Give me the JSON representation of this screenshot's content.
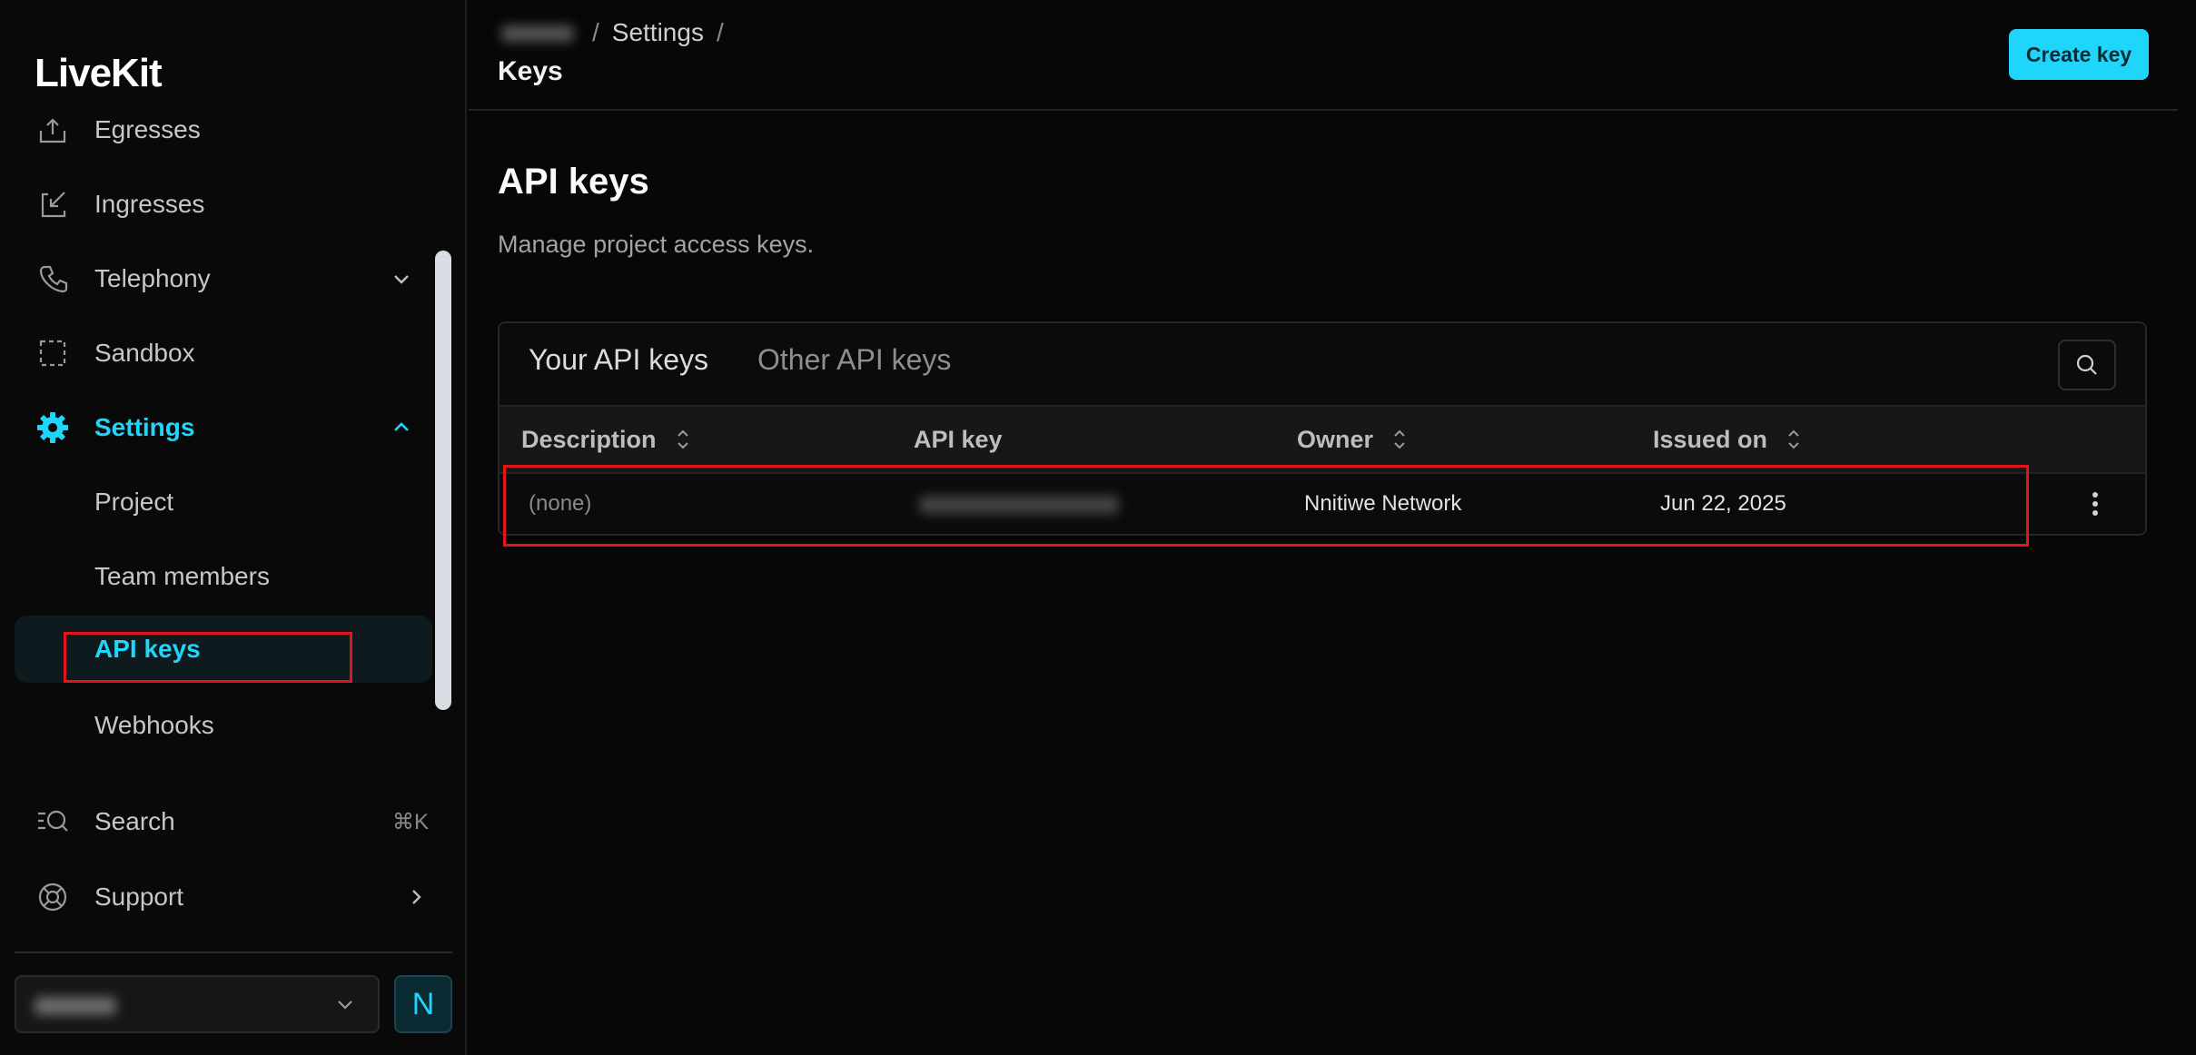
{
  "sidebar": {
    "logo": "LiveKit",
    "items": [
      {
        "label": "Egresses",
        "icon": "egress-icon"
      },
      {
        "label": "Ingresses",
        "icon": "ingress-icon"
      },
      {
        "label": "Telephony",
        "icon": "phone-icon"
      },
      {
        "label": "Sandbox",
        "icon": "sandbox-icon"
      },
      {
        "label": "Settings",
        "icon": "gear-icon"
      }
    ],
    "settings_children": [
      {
        "label": "Project"
      },
      {
        "label": "Team members"
      },
      {
        "label": "API keys"
      },
      {
        "label": "Webhooks"
      }
    ],
    "search": {
      "label": "Search",
      "shortcut": "⌘K"
    },
    "support": {
      "label": "Support"
    },
    "avatar_initial": "N"
  },
  "header": {
    "breadcrumb_settings": "Settings",
    "breadcrumb_sep": "/",
    "title": "Keys",
    "create_label": "Create key"
  },
  "content": {
    "heading": "API keys",
    "subheading": "Manage project access keys.",
    "tabs": [
      {
        "label": "Your API keys",
        "active": true
      },
      {
        "label": "Other API keys",
        "active": false
      }
    ],
    "columns": [
      "Description",
      "API key",
      "Owner",
      "Issued on"
    ],
    "rows": [
      {
        "description": "(none)",
        "owner": "Nnitiwe Network",
        "issued_on": "Jun 22, 2025"
      }
    ]
  },
  "colors": {
    "accent": "#1fd5f9",
    "background": "#070707",
    "highlight": "#e5131a"
  }
}
